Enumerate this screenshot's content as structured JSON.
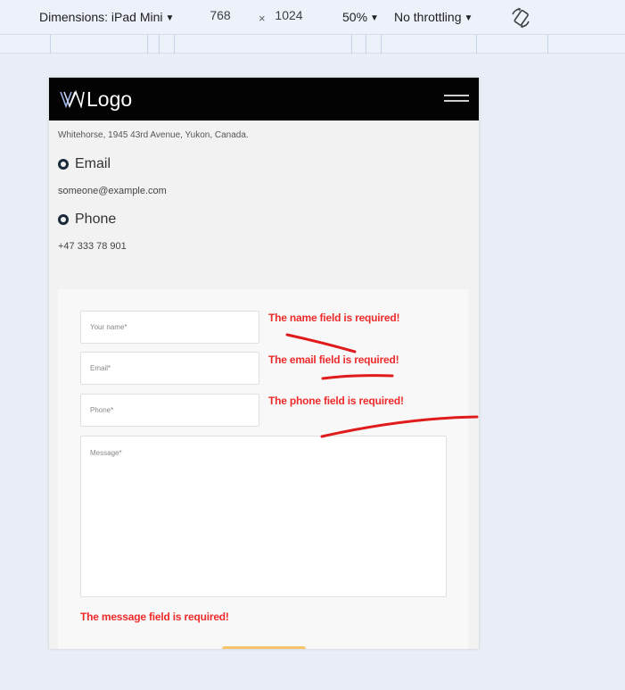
{
  "devtools": {
    "dimensions_label": "Dimensions: iPad Mini",
    "width": "768",
    "times": "×",
    "height": "1024",
    "zoom": "50%",
    "throttling": "No throttling",
    "rotate_icon": "rotate-icon"
  },
  "site": {
    "logo_text": "Logo",
    "address": "Whitehorse, 1945 43rd Avenue, Yukon, Canada.",
    "email_heading": "Email",
    "email_value": "someone@example.com",
    "phone_heading": "Phone",
    "phone_value": "+47 333 78 901"
  },
  "form": {
    "name_placeholder": "Your name*",
    "email_placeholder": "Email*",
    "phone_placeholder": "Phone*",
    "message_placeholder": "Message*",
    "name_error": "The name field is required!",
    "email_error": "The email field is required!",
    "phone_error": "The phone field is required!",
    "message_error": "The message field is required!"
  },
  "colors": {
    "error": "#ee2b2b",
    "annotation": "#e01b1b",
    "header_bg": "#030303",
    "submit": "#f5c469"
  }
}
